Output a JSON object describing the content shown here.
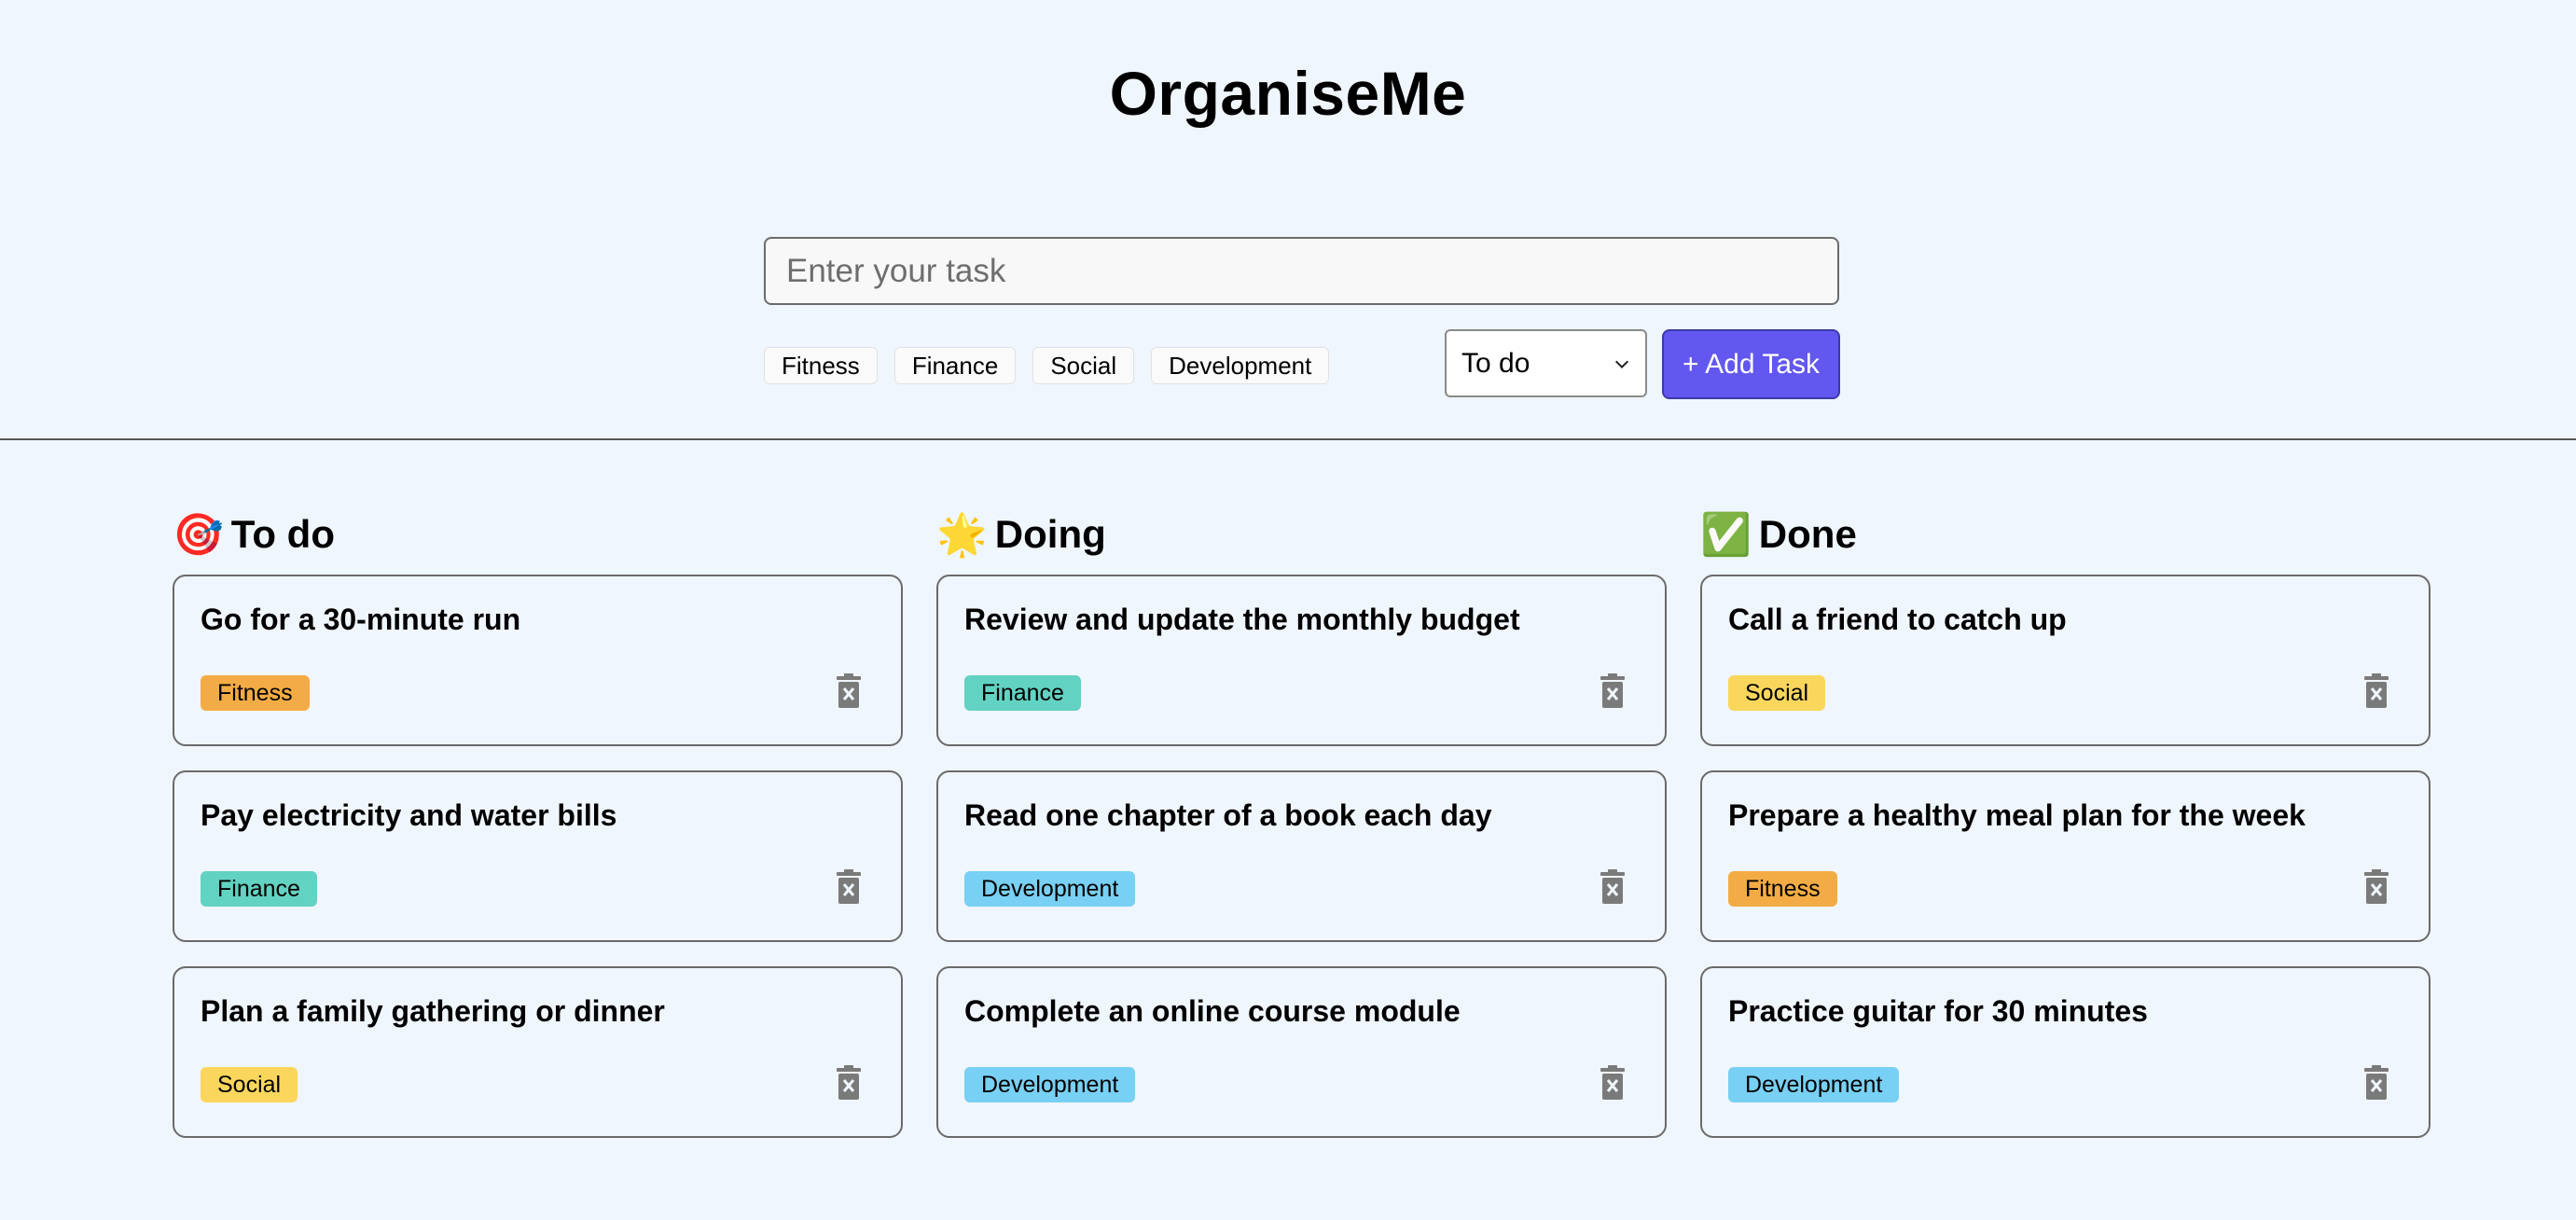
{
  "app": {
    "title": "OrganiseMe"
  },
  "form": {
    "placeholder": "Enter your task",
    "value": "",
    "tags": [
      "Fitness",
      "Finance",
      "Social",
      "Development"
    ],
    "status_selected": "To do",
    "add_label": "+ Add Task"
  },
  "tag_colors": {
    "Fitness": "#f3ac45",
    "Finance": "#62d2c2",
    "Social": "#fad75c",
    "Development": "#78d0f4",
    "accent": "#6257ef"
  },
  "columns": [
    {
      "icon": "target-icon",
      "emoji": "🎯",
      "title": "To do",
      "tasks": [
        {
          "title": "Go for a 30-minute run",
          "tag": "Fitness"
        },
        {
          "title": "Pay electricity and water bills",
          "tag": "Finance"
        },
        {
          "title": "Plan a family gathering or dinner",
          "tag": "Social"
        }
      ]
    },
    {
      "icon": "star-icon",
      "emoji": "🌟",
      "title": "Doing",
      "tasks": [
        {
          "title": "Review and update the monthly budget",
          "tag": "Finance"
        },
        {
          "title": "Read one chapter of a book each day",
          "tag": "Development"
        },
        {
          "title": "Complete an online course module",
          "tag": "Development"
        }
      ]
    },
    {
      "icon": "check-mark-icon",
      "emoji": "✅",
      "title": "Done",
      "tasks": [
        {
          "title": "Call a friend to catch up",
          "tag": "Social"
        },
        {
          "title": "Prepare a healthy meal plan for the week",
          "tag": "Fitness"
        },
        {
          "title": "Practice guitar for 30 minutes",
          "tag": "Development"
        }
      ]
    }
  ]
}
